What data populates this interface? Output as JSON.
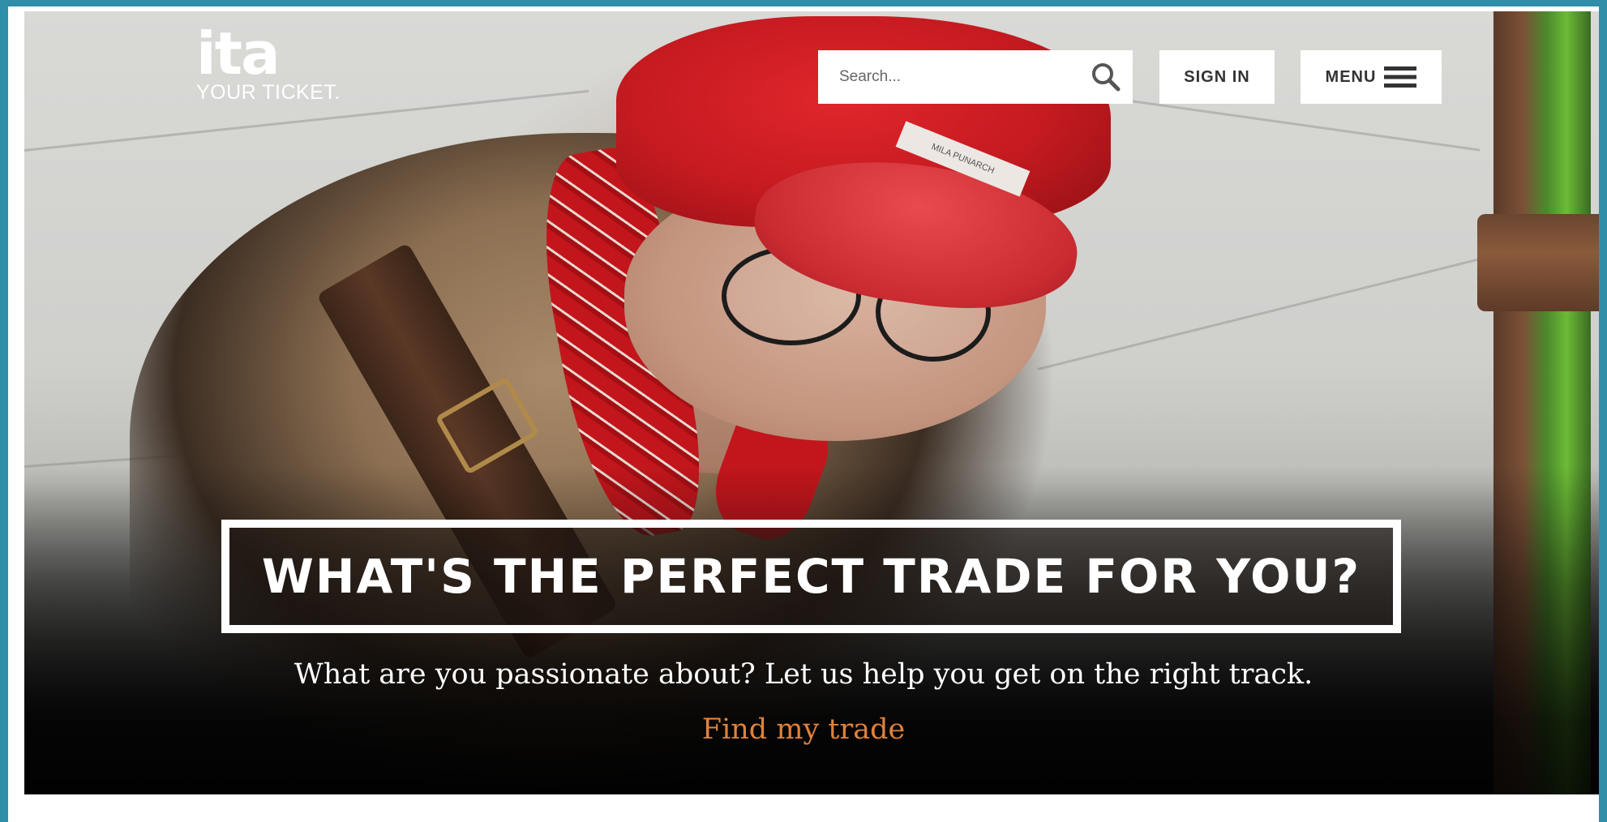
{
  "brand": {
    "logo_text": "ita",
    "tagline": "YOUR TICKET."
  },
  "header": {
    "search": {
      "placeholder": "Search...",
      "icon": "search-icon"
    },
    "signin_label": "SIGN IN",
    "menu_label": "MENU",
    "menu_icon": "hamburger-icon"
  },
  "hero": {
    "headline": "WHAT'S THE PERFECT TRADE FOR YOU?",
    "subheadline": "What are you passionate about? Let us help you get on the right track.",
    "cta_label": "Find my trade",
    "hat_label": "MILA PUNARCH"
  },
  "colors": {
    "frame_border": "#2f8fa8",
    "cta": "#e0823a",
    "hat_red": "#c41a20",
    "text_light": "#ffffff",
    "button_bg": "#ffffff"
  }
}
